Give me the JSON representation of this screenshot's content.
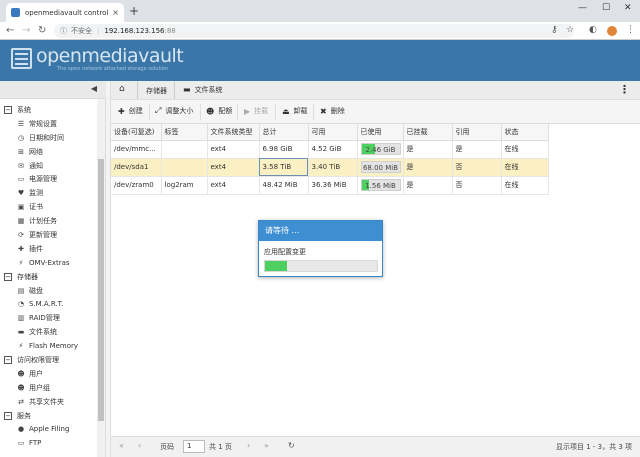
{
  "browser": {
    "tab_title": "openmediavault control panel",
    "tab_close": "×",
    "new_tab": "+",
    "insecure_label": "不安全",
    "url_host": "192.168.123.156",
    "url_port": ":88",
    "min": "—",
    "max": "☐",
    "close": "✕"
  },
  "header": {
    "logo_text": "openmediavault",
    "logo_sub": "The open network attached storage solution"
  },
  "sidebar": {
    "groups": [
      {
        "label": "系统",
        "items": [
          {
            "icon": "sliders-icon",
            "glyph": "☰",
            "label": "常规设置"
          },
          {
            "icon": "clock-icon",
            "glyph": "◷",
            "label": "日期和时间"
          },
          {
            "icon": "network-icon",
            "glyph": "⊞",
            "label": "网络"
          },
          {
            "icon": "envelope-icon",
            "glyph": "✉",
            "label": "通知"
          },
          {
            "icon": "power-icon",
            "glyph": "▭",
            "label": "电源管理"
          },
          {
            "icon": "monitor-icon",
            "glyph": "♥",
            "label": "监测"
          },
          {
            "icon": "certificate-icon",
            "glyph": "▣",
            "label": "证书"
          },
          {
            "icon": "calendar-icon",
            "glyph": "▦",
            "label": "计划任务"
          },
          {
            "icon": "update-icon",
            "glyph": "⟳",
            "label": "更新管理"
          },
          {
            "icon": "plugin-icon",
            "glyph": "✚",
            "label": "插件"
          },
          {
            "icon": "extras-icon",
            "glyph": "⚡",
            "label": "OMV-Extras"
          }
        ]
      },
      {
        "label": "存储器",
        "items": [
          {
            "icon": "disk-icon",
            "glyph": "▤",
            "label": "磁盘"
          },
          {
            "icon": "smart-icon",
            "glyph": "◔",
            "label": "S.M.A.R.T."
          },
          {
            "icon": "raid-icon",
            "glyph": "▥",
            "label": "RAID管理"
          },
          {
            "icon": "filesystem-icon",
            "glyph": "▬",
            "label": "文件系统"
          },
          {
            "icon": "flash-icon",
            "glyph": "⚡",
            "label": "Flash Memory"
          }
        ]
      },
      {
        "label": "访问权限管理",
        "items": [
          {
            "icon": "user-icon",
            "glyph": "☻",
            "label": "用户"
          },
          {
            "icon": "users-icon",
            "glyph": "☻",
            "label": "用户组"
          },
          {
            "icon": "share-icon",
            "glyph": "⇄",
            "label": "共享文件夹"
          }
        ]
      },
      {
        "label": "服务",
        "items": [
          {
            "icon": "apple-icon",
            "glyph": "●",
            "label": "Apple Filing"
          },
          {
            "icon": "ftp-icon",
            "glyph": "▭",
            "label": "FTP"
          }
        ]
      }
    ]
  },
  "breadcrumb": {
    "level1": "存储器",
    "level2": "文件系统"
  },
  "toolbar": {
    "create": "创建",
    "resize": "调整大小",
    "quota": "配额",
    "mount": "挂载",
    "unmount": "卸载",
    "delete": "删除"
  },
  "grid": {
    "columns": [
      "设备(可复选)",
      "标签",
      "文件系统类型",
      "总计",
      "可用",
      "已使用",
      "已挂载",
      "引用",
      "状态"
    ],
    "rows": [
      {
        "device": "/dev/mmc...",
        "label": "",
        "type": "ext4",
        "total": "6.98 GiB",
        "free": "4.52 GiB",
        "used": "2.46 GiB",
        "used_frac": 0.35,
        "mounted": "是",
        "referenced": "是",
        "status": "在线"
      },
      {
        "device": "/dev/sda1",
        "label": "",
        "type": "ext4",
        "total": "3.58 TiB",
        "free": "3.40 TiB",
        "used": "68.00 MiB",
        "used_frac": 0.0,
        "mounted": "是",
        "referenced": "否",
        "status": "在线"
      },
      {
        "device": "/dev/zram0",
        "label": "log2ram",
        "type": "ext4",
        "total": "48.42 MiB",
        "free": "36.36 MiB",
        "used": "1.56 MiB",
        "used_frac": 0.2,
        "mounted": "是",
        "referenced": "否",
        "status": "在线"
      }
    ]
  },
  "pager": {
    "page_label": "页码",
    "page_value": "1",
    "of_total": "共 1 页",
    "info": "显示项目 1 - 3，共 3 项"
  },
  "dialog": {
    "title": "请等待 ...",
    "message": "应用配置变更",
    "progress": 0.2
  },
  "colors": {
    "header_blue": "#3a77a8",
    "dialog_blue": "#3d8fd2",
    "progress_green": "#4ed060",
    "selected_row": "#fbf0c4"
  }
}
